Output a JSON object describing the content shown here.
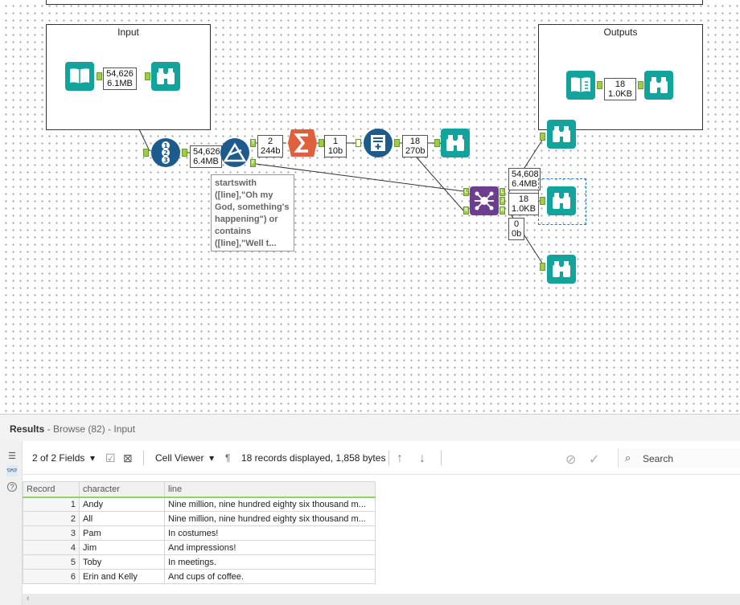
{
  "canvas": {
    "containers": {
      "input_title": "Input",
      "outputs_title": "Outputs"
    },
    "counts": {
      "input_out": [
        "54,626",
        "6.1MB"
      ],
      "record_id_out": [
        "54,626",
        "6.4MB"
      ],
      "filter_true": [
        "2",
        "244b"
      ],
      "summarize_out": [
        "1",
        "10b"
      ],
      "append_out": [
        "18",
        "270b"
      ],
      "output_box": [
        "18",
        "1.0KB"
      ],
      "join_left": [
        "54,608",
        "6.4MB"
      ],
      "join_join": [
        "18",
        "1.0KB"
      ],
      "join_right": [
        "0",
        "0b"
      ]
    },
    "anchors": {
      "filter_true": "T",
      "filter_false": "F",
      "join_in_left": "L",
      "join_in_right": "R",
      "join_out_left": "L",
      "join_out_join": "J",
      "join_out_right": "R"
    },
    "annotation": "startswith ([line],\"Oh my God, something's happening\") or contains ([line],\"Well t...",
    "colors": {
      "teal": "#11a39c",
      "blue": "#1d5b8c",
      "summarize": "#e0603e",
      "join": "#6b3f8e",
      "anchor": "#9bcc4a"
    }
  },
  "results": {
    "title": "Results",
    "subtitle": " - Browse (82) - Input",
    "toolbar": {
      "fields": "2 of 2 Fields",
      "viewer": "Cell Viewer",
      "pilcrow": "¶",
      "status": "18 records displayed, 1,858 bytes",
      "search_placeholder": "Search"
    },
    "columns": [
      "Record",
      "character",
      "line"
    ],
    "rows": [
      {
        "record": "1",
        "character": "Andy",
        "line": "Nine million, nine hundred eighty six thousand m..."
      },
      {
        "record": "2",
        "character": "All",
        "line": "Nine million, nine hundred eighty six thousand m..."
      },
      {
        "record": "3",
        "character": "Pam",
        "line": "In costumes!"
      },
      {
        "record": "4",
        "character": "Jim",
        "line": "And impressions!"
      },
      {
        "record": "5",
        "character": "Toby",
        "line": "In meetings."
      },
      {
        "record": "6",
        "character": "Erin and Kelly",
        "line": "And cups of coffee."
      }
    ]
  }
}
